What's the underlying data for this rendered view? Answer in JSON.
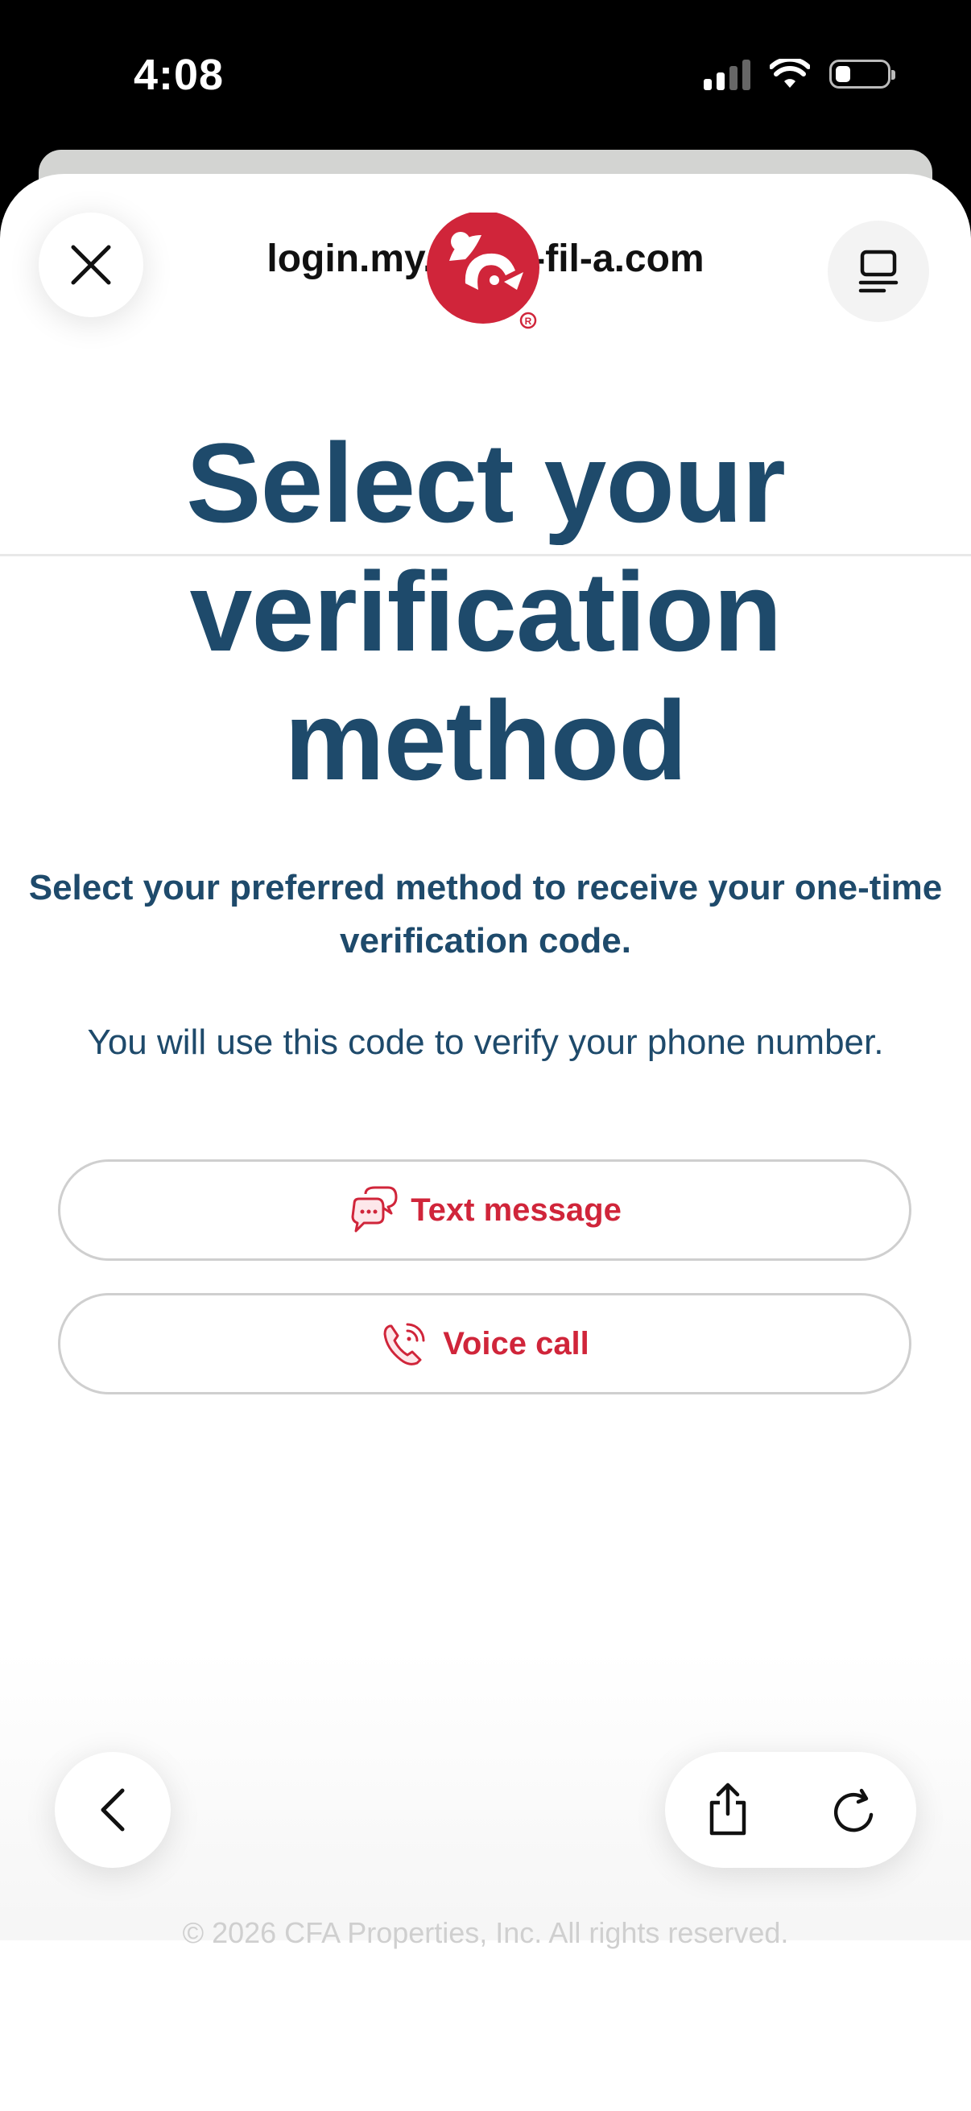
{
  "status_bar": {
    "time": "4:08",
    "icons": [
      "cellular-signal-icon",
      "wifi-icon",
      "battery-icon"
    ]
  },
  "browser": {
    "url": "login.my.chick-fil-a.com",
    "close_icon": "close-icon",
    "reader_icon": "reader-mode-icon"
  },
  "brand": {
    "logo": "chick-fil-a-logo",
    "color": "#d0253a"
  },
  "page": {
    "heading_lines": [
      "Select your",
      "verification",
      "method"
    ],
    "subtitle_line1": "Select your preferred method to receive your one-time",
    "subtitle_line2": "verification code.",
    "note": "You will use this code to verify your phone number.",
    "text_color": "#1e4a6b"
  },
  "options": [
    {
      "label": "Text message",
      "icon": "chat-bubbles-icon"
    },
    {
      "label": "Voice call",
      "icon": "phone-ringing-icon"
    }
  ],
  "footer": "© 2026 CFA Properties, Inc. All rights reserved.",
  "toolbar": {
    "back_icon": "chevron-left-icon",
    "share_icon": "share-icon",
    "reload_icon": "reload-icon"
  }
}
